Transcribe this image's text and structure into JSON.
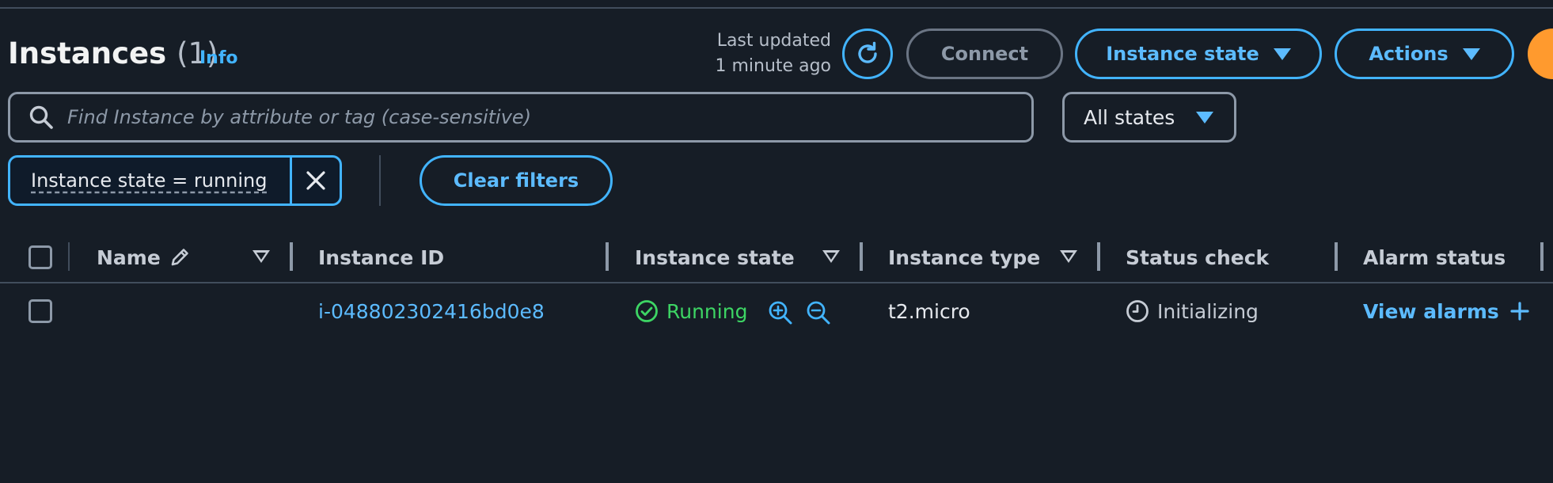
{
  "header": {
    "title": "Instances",
    "count": "(1)",
    "info_label": "Info",
    "last_updated_line1": "Last updated",
    "last_updated_line2": "1 minute ago",
    "refresh_icon": "refresh-icon",
    "connect_label": "Connect",
    "instance_state_label": "Instance state",
    "actions_label": "Actions"
  },
  "search": {
    "placeholder": "Find Instance by attribute or tag (case-sensitive)",
    "value": "",
    "states_selected": "All states"
  },
  "filters": {
    "tokens": [
      {
        "label": "Instance state = running"
      }
    ],
    "clear_label": "Clear filters"
  },
  "table": {
    "columns": [
      {
        "label": "Name"
      },
      {
        "label": "Instance ID"
      },
      {
        "label": "Instance state"
      },
      {
        "label": "Instance type"
      },
      {
        "label": "Status check"
      },
      {
        "label": "Alarm status"
      }
    ],
    "rows": [
      {
        "name": "",
        "instance_id": "i-048802302416bd0e8",
        "state": "Running",
        "type": "t2.micro",
        "status_check": "Initializing",
        "alarm_status": "View alarms"
      }
    ]
  },
  "colors": {
    "background": "#161d26",
    "accent_blue": "#42b4ff",
    "running_green": "#3dd564",
    "orange": "#ff9a2e"
  }
}
